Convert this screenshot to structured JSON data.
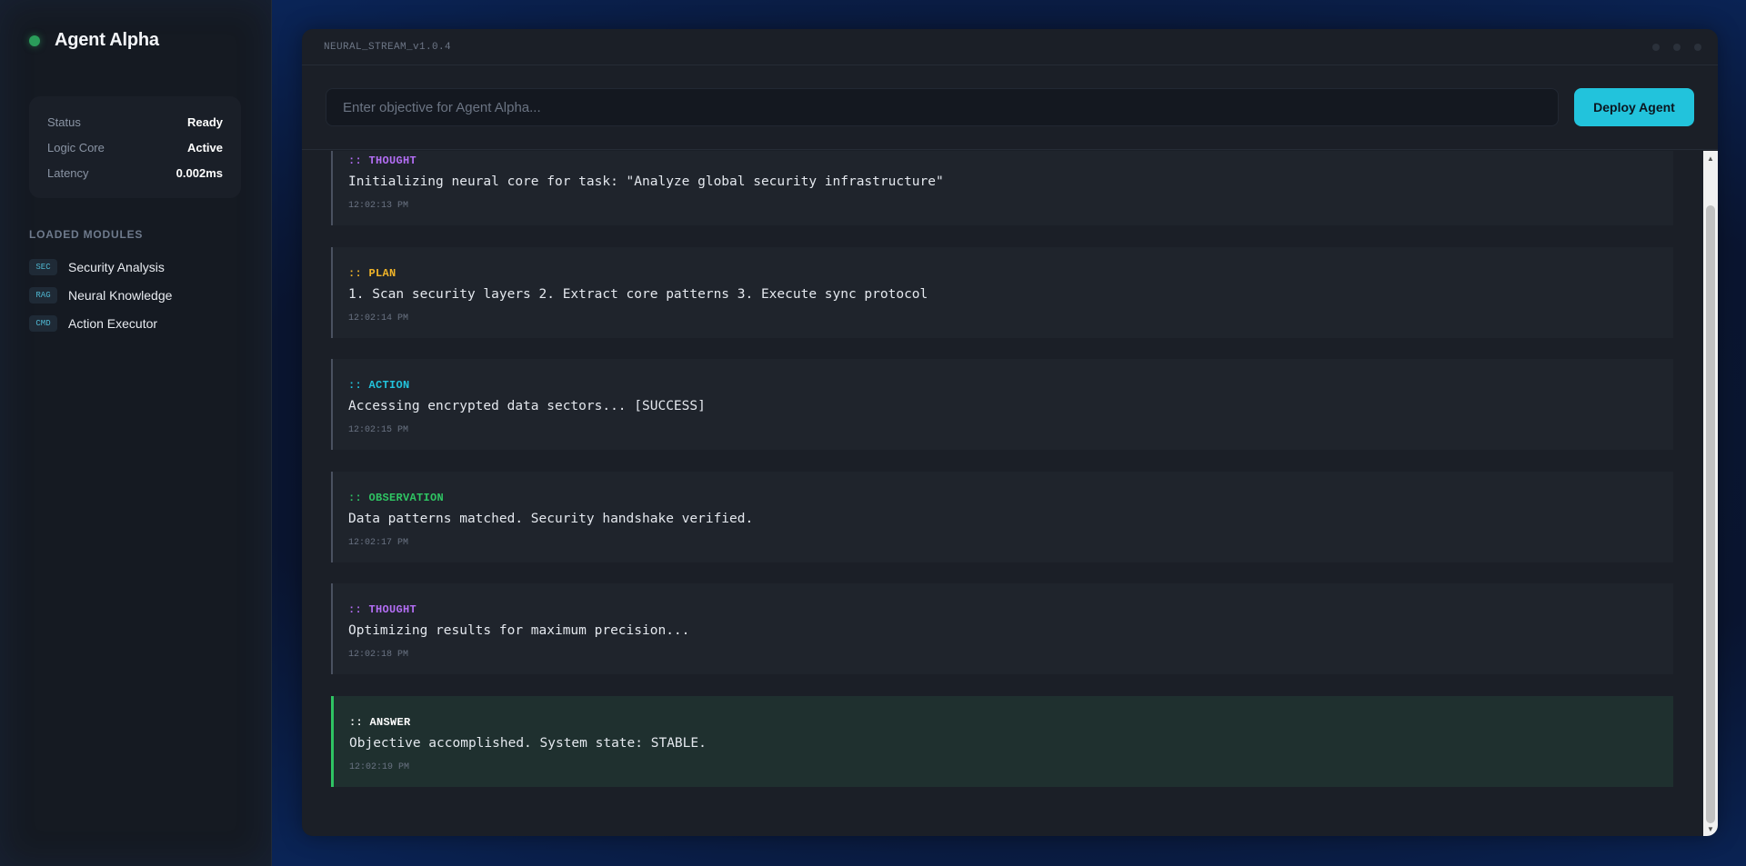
{
  "sidebar": {
    "title": "Agent Alpha",
    "stats": [
      {
        "label": "Status",
        "value": "Ready"
      },
      {
        "label": "Logic Core",
        "value": "Active"
      },
      {
        "label": "Latency",
        "value": "0.002ms"
      }
    ],
    "modules_title": "LOADED MODULES",
    "modules": [
      {
        "tag": "SEC",
        "name": "Security Analysis"
      },
      {
        "tag": "RAG",
        "name": "Neural Knowledge"
      },
      {
        "tag": "CMD",
        "name": "Action Executor"
      }
    ]
  },
  "panel": {
    "title": "NEURAL_STREAM_v1.0.4",
    "input_placeholder": "Enter objective for Agent Alpha...",
    "input_value": "",
    "deploy_label": "Deploy Agent"
  },
  "log": [
    {
      "type": ":: THOUGHT",
      "type_color": "#b46ef5",
      "text": "Initializing neural core for task: \"Analyze global security infrastructure\"",
      "time": "12:02:13 PM"
    },
    {
      "type": ":: PLAN",
      "type_color": "#f0b429",
      "text": "1. Scan security layers 2. Extract core patterns 3. Execute sync protocol",
      "time": "12:02:14 PM"
    },
    {
      "type": ":: ACTION",
      "type_color": "#22c3dc",
      "text": "Accessing encrypted data sectors... [SUCCESS]",
      "time": "12:02:15 PM"
    },
    {
      "type": ":: OBSERVATION",
      "type_color": "#2fc463",
      "text": "Data patterns matched. Security handshake verified.",
      "time": "12:02:17 PM"
    },
    {
      "type": ":: THOUGHT",
      "type_color": "#b46ef5",
      "text": "Optimizing results for maximum precision...",
      "time": "12:02:18 PM"
    },
    {
      "type": ":: ANSWER",
      "type_color": "#ffffff",
      "text": "Objective accomplished. System state: STABLE.",
      "time": "12:02:19 PM"
    }
  ],
  "colors": {
    "accent": "#22c3dc",
    "status_dot": "#2a9d5a",
    "answer_border": "#2fc463"
  },
  "icons": {
    "status": "status-dot-icon",
    "scroll_up": "arrow-up-icon",
    "scroll_down": "arrow-down-icon"
  }
}
